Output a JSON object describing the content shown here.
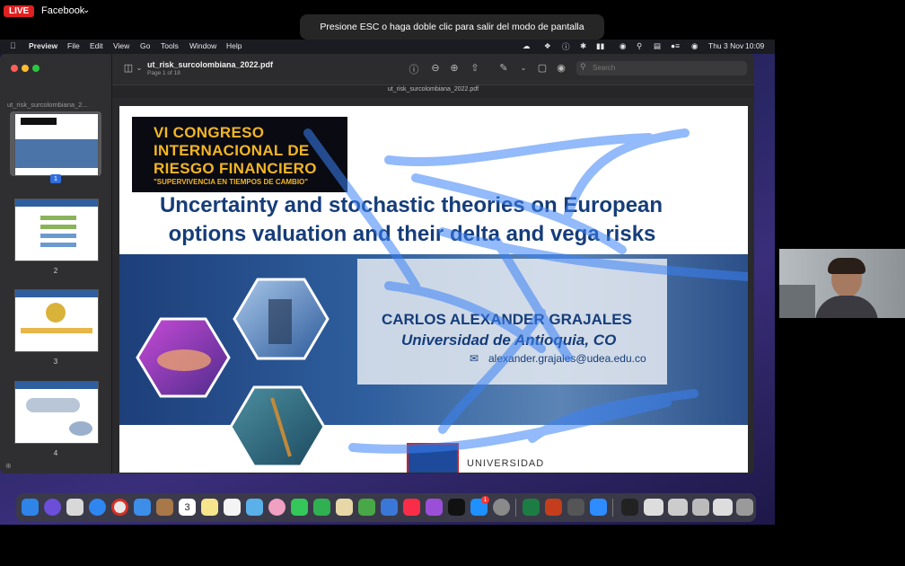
{
  "stream": {
    "live_label": "LIVE",
    "platform": "Facebook"
  },
  "fullscreen_notice": "Presione ESC o haga doble clic para salir del modo de pantalla completa",
  "menubar": {
    "app": "Preview",
    "items": [
      "File",
      "Edit",
      "View",
      "Go",
      "Tools",
      "Window",
      "Help"
    ],
    "clock_day": "Thu 3 Nov",
    "clock_time": "10:09"
  },
  "window": {
    "sidebar_title": "ut_risk_surcolombiana_2...",
    "thumbnails": [
      "1",
      "2",
      "3",
      "4"
    ],
    "doc_name": "ut_risk_surcolombiana_2022.pdf",
    "page_info": "Page 1 of 18",
    "tab_name": "ut_risk_surcolombiana_2022.pdf",
    "search_placeholder": "Search"
  },
  "slide": {
    "logo_line1": "VI CONGRESO",
    "logo_line2": "INTERNACIONAL DE",
    "logo_line3": "RIESGO FINANCIERO",
    "logo_line4": "\"SUPERVIVENCIA EN TIEMPOS DE CAMBIO\"",
    "title_line1": "Uncertainty and stochastic theories on European",
    "title_line2": "options valuation and their delta and vega risks",
    "author": "CARLOS ALEXANDER GRAJALES",
    "university": "Universidad de Antioquia, CO",
    "email": "alexander.grajales@udea.edu.co",
    "bottom_text": "UNIVERSIDAD"
  },
  "dock": {
    "calendar_day": "3",
    "app_store_badge": "1"
  },
  "colors": {
    "title_blue": "#163d7a",
    "logo_gold": "#f2b523",
    "live_red": "#e02020",
    "annotation_blue": "#3b82f6"
  }
}
